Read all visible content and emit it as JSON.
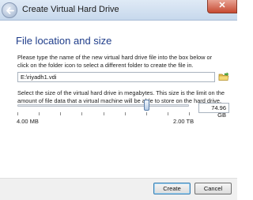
{
  "window": {
    "title": "Create Virtual Hard Drive",
    "close_glyph": "✕",
    "back_icon": "back-arrow-icon"
  },
  "section": {
    "heading": "File location and size",
    "location_description": "Please type the name of the new virtual hard drive file into the box below or click on the folder icon to select a different folder to create the file in.",
    "file_path": "E:\\riyadh1.vdi",
    "folder_icon": "folder-icon",
    "size_description": "Select the size of the virtual hard drive in megabytes. This size is the limit on the amount of file data that a virtual machine will be able to store on the hard drive."
  },
  "size": {
    "value": "74.96 GB",
    "min_label": "4.00 MB",
    "max_label": "2.00 TB",
    "slider_fraction": 0.755
  },
  "buttons": {
    "create": "Create",
    "cancel": "Cancel"
  },
  "colors": {
    "heading": "#1f3d8a",
    "titlebar": "#c7d8ec",
    "close": "#c74a32"
  }
}
